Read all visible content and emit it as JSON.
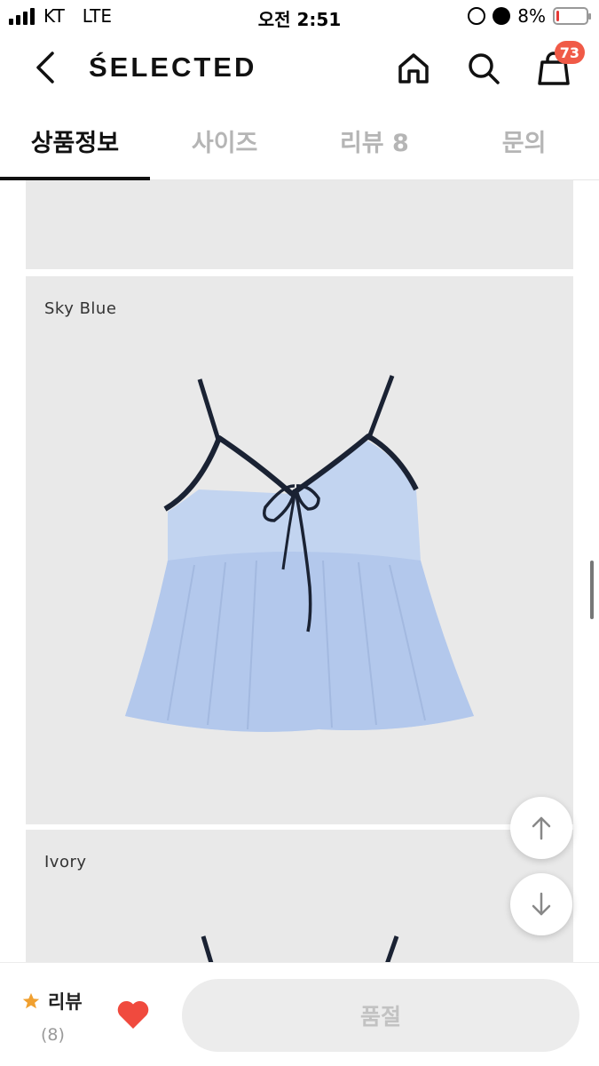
{
  "status_bar": {
    "carrier": "KT",
    "network": "LTE",
    "time": "오전 2:51",
    "battery_percent": "8%",
    "battery_level": 0.08,
    "battery_color": "#e53935"
  },
  "header": {
    "logo": "ŚELECTED",
    "back_icon": "chevron-left-icon",
    "home_icon": "home-icon",
    "search_icon": "search-icon",
    "cart_icon": "shopping-bag-icon",
    "cart_count": "73",
    "badge_color": "#f05a47"
  },
  "tabs": [
    {
      "label": "상품정보",
      "active": true
    },
    {
      "label": "사이즈",
      "active": false
    },
    {
      "label": "리뷰 8",
      "active": false
    },
    {
      "label": "문의",
      "active": false
    }
  ],
  "content": {
    "panels": [
      {
        "label": ""
      },
      {
        "label": "Sky Blue"
      },
      {
        "label": "Ivory"
      }
    ]
  },
  "floating_buttons": {
    "up_icon": "arrow-up-icon",
    "down_icon": "arrow-down-icon"
  },
  "bottom_bar": {
    "review_label": "리뷰",
    "review_count": "(8)",
    "star_icon": "star-icon",
    "star_color": "#f0a030",
    "heart_icon": "heart-icon",
    "heart_color": "#f04a3e",
    "buy_button_label": "품절"
  }
}
